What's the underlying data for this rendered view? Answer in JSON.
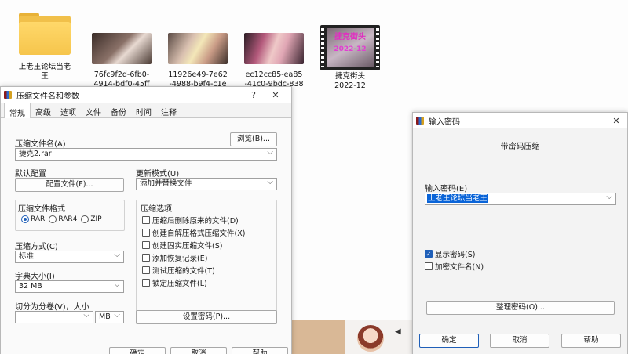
{
  "desktop": {
    "files": [
      {
        "name": "上老王论坛当老王",
        "kind": "folder"
      },
      {
        "name": "76fc9f2d-6fb0-4914-bdf0-45ff",
        "kind": "video"
      },
      {
        "name": "11926e49-7e62-4988-b9f4-c1e",
        "kind": "video"
      },
      {
        "name": "ec12cc85-ea85-41c0-9bdc-838",
        "kind": "video"
      },
      {
        "name": "捷克街头 2022-12",
        "kind": "video-film",
        "overlay_line1": "捷克街头",
        "overlay_line2": "2022-12"
      }
    ]
  },
  "archive_dialog": {
    "title": "压缩文件名和参数",
    "help_glyph": "?",
    "close_glyph": "✕",
    "tabs": [
      "常规",
      "高级",
      "选项",
      "文件",
      "备份",
      "时间",
      "注释"
    ],
    "active_tab": "常规",
    "archive_name_label": "压缩文件名(A)",
    "browse_button": "浏览(B)...",
    "archive_name_value": "捷克2.rar",
    "default_profile_label": "默认配置",
    "profiles_button": "配置文件(F)...",
    "update_mode_label": "更新模式(U)",
    "update_mode_value": "添加并替换文件",
    "format_label": "压缩文件格式",
    "formats": [
      "RAR",
      "RAR4",
      "ZIP"
    ],
    "selected_format": "RAR",
    "options_label": "压缩选项",
    "options": [
      {
        "label": "压缩后删除原来的文件(D)",
        "checked": false
      },
      {
        "label": "创建自解压格式压缩文件(X)",
        "checked": false
      },
      {
        "label": "创建固实压缩文件(S)",
        "checked": false
      },
      {
        "label": "添加恢复记录(E)",
        "checked": false
      },
      {
        "label": "测试压缩的文件(T)",
        "checked": false
      },
      {
        "label": "锁定压缩文件(L)",
        "checked": false
      }
    ],
    "method_label": "压缩方式(C)",
    "method_value": "标准",
    "dict_label": "字典大小(I)",
    "dict_value": "32 MB",
    "split_label": "切分为分卷(V)，大小",
    "split_value": "",
    "split_unit": "MB",
    "set_password_button": "设置密码(P)...",
    "ok_button": "确定",
    "cancel_button": "取消",
    "help_button": "帮助"
  },
  "password_dialog": {
    "title": "输入密码",
    "close_glyph": "✕",
    "heading": "带密码压缩",
    "password_label": "输入密码(E)",
    "password_value": "上老王论坛当老王",
    "show_password_label": "显示密码(S)",
    "show_password_checked": true,
    "encrypt_names_label": "加密文件名(N)",
    "encrypt_names_checked": false,
    "organize_button": "整理密码(O)...",
    "ok_button": "确定",
    "cancel_button": "取消",
    "help_button": "帮助"
  },
  "colors": {
    "accent": "#1f5fb8",
    "selection": "#0a64d8",
    "dialog_bg": "#f3f3f3"
  }
}
